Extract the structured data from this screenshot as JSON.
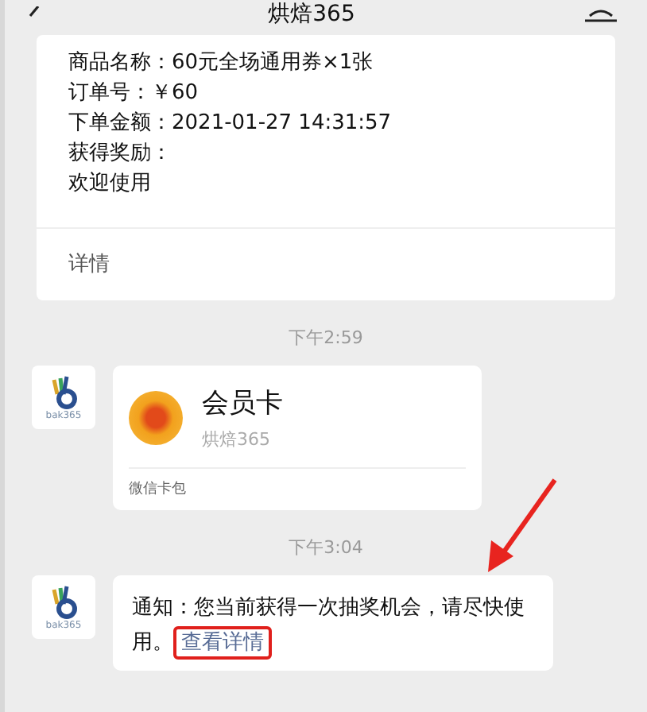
{
  "header": {
    "title": "烘焙365"
  },
  "order_card": {
    "lines": [
      "商品名称：60元全场通用券×1张",
      "订单号：￥60",
      "下单金额：2021-01-27 14:31:57",
      "获得奖励：",
      "欢迎使用"
    ],
    "link": "详情"
  },
  "messages": [
    {
      "kind": "time",
      "text": "下午2:59"
    },
    {
      "kind": "card",
      "avatar_text": "bak365",
      "title": "会员卡",
      "subtitle": "烘焙365",
      "footer": "微信卡包"
    },
    {
      "kind": "time",
      "text": "下午3:04"
    },
    {
      "kind": "text",
      "avatar_text": "bak365",
      "text": "通知：您当前获得一次抽奖机会，请尽快使用。",
      "link": "查看详情",
      "highlighted": true
    }
  ]
}
